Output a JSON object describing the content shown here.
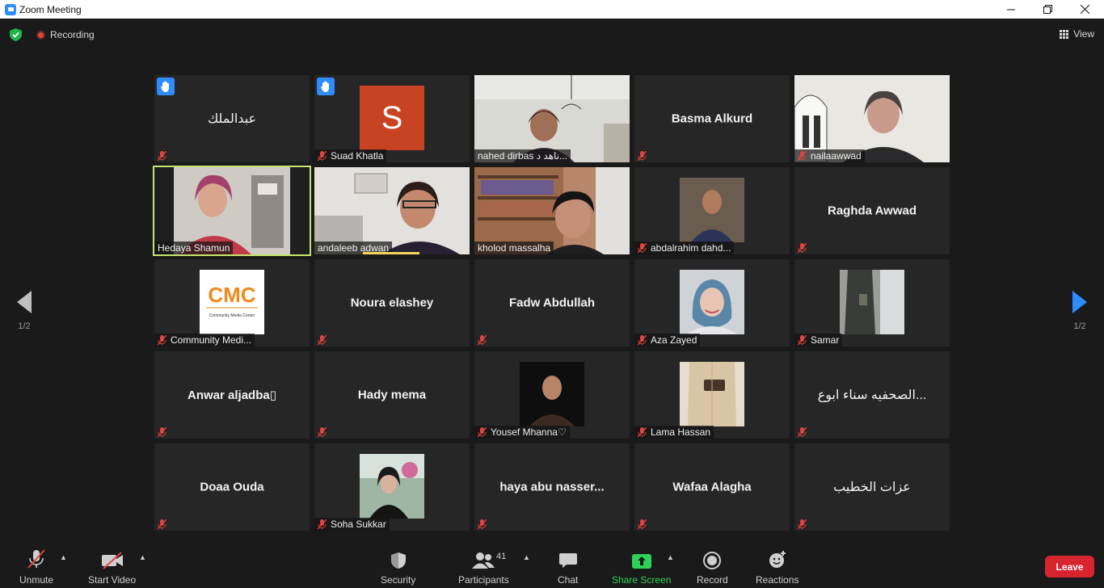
{
  "window": {
    "title": "Zoom Meeting",
    "minimize": "—",
    "maximize": "❐",
    "close": "✕"
  },
  "topbar": {
    "recording": "Recording",
    "view": "View"
  },
  "pagination": {
    "left": "1/2",
    "right": "1/2"
  },
  "tiles": [
    {
      "name": "عبدالملك",
      "label": "",
      "hand": true,
      "kind": "text-normal"
    },
    {
      "name": "",
      "label": "Suad Khatla",
      "hand": true,
      "kind": "avatar",
      "avatar_letter": "S"
    },
    {
      "name": "",
      "label": "nahed dirbas ناهد د...",
      "kind": "video",
      "muted": false
    },
    {
      "name": "Basma Alkurd",
      "label": "",
      "kind": "text"
    },
    {
      "name": "",
      "label": "nailaawwad",
      "kind": "video",
      "muted": true
    },
    {
      "name": "",
      "label": "Hedaya Shamun",
      "kind": "video",
      "muted": false,
      "active": true
    },
    {
      "name": "",
      "label": "andaleeb adwan",
      "kind": "video",
      "muted": false,
      "speaking": true
    },
    {
      "name": "",
      "label": "kholod massalha",
      "kind": "video",
      "muted": false
    },
    {
      "name": "",
      "label": "abdalrahim dahd...",
      "kind": "photo",
      "muted": true
    },
    {
      "name": "Raghda Awwad",
      "label": "",
      "kind": "text"
    },
    {
      "name": "",
      "label": "Community Medi...",
      "kind": "logo",
      "muted": true,
      "logo_text": "CMC",
      "logo_sub": "Community Media Center"
    },
    {
      "name": "Noura elashey",
      "label": "",
      "kind": "text"
    },
    {
      "name": "Fadw Abdullah",
      "label": "",
      "kind": "text"
    },
    {
      "name": "",
      "label": "Aza Zayed",
      "kind": "photo",
      "muted": true
    },
    {
      "name": "",
      "label": "Samar",
      "kind": "photo",
      "muted": true
    },
    {
      "name": "Anwar  aljadba▯",
      "label": "",
      "kind": "text"
    },
    {
      "name": "Hady mema",
      "label": "",
      "kind": "text"
    },
    {
      "name": "",
      "label": "Yousef Mhanna♡",
      "kind": "photo",
      "muted": true
    },
    {
      "name": "",
      "label": "Lama Hassan",
      "kind": "photo",
      "muted": true
    },
    {
      "name": "الصحفيه سناء ابوع...",
      "label": "",
      "kind": "text-normal"
    },
    {
      "name": "Doaa Ouda",
      "label": "",
      "kind": "text"
    },
    {
      "name": "",
      "label": "Soha Sukkar",
      "kind": "photo",
      "muted": true
    },
    {
      "name": "haya abu nasser...",
      "label": "",
      "kind": "text"
    },
    {
      "name": "Wafaa Alagha",
      "label": "",
      "kind": "text"
    },
    {
      "name": "عزات الخطيب",
      "label": "",
      "kind": "text-normal"
    }
  ],
  "toolbar": {
    "unmute": "Unmute",
    "start_video": "Start Video",
    "security": "Security",
    "participants": "Participants",
    "participants_count": "41",
    "chat": "Chat",
    "share_screen": "Share Screen",
    "record": "Record",
    "reactions": "Reactions",
    "leave": "Leave"
  },
  "colors": {
    "accent": "#2d8cff",
    "share": "#2fd158",
    "leave": "#d7242f",
    "active_border": "#c5e66c",
    "muted": "#e0443e"
  }
}
